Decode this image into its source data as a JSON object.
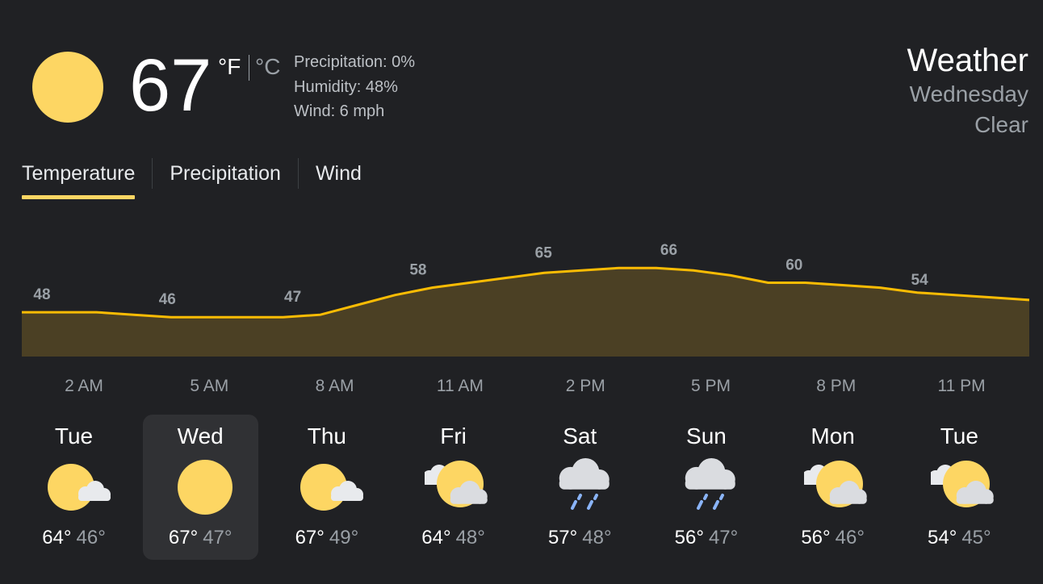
{
  "current": {
    "icon": "sun-icon",
    "temperature": "67",
    "unit_f": "°F",
    "unit_c": "°C",
    "precipitation": "Precipitation: 0%",
    "humidity": "Humidity: 48%",
    "wind": "Wind: 6 mph"
  },
  "place": {
    "title": "Weather",
    "day": "Wednesday",
    "condition": "Clear"
  },
  "tabs": [
    {
      "label": "Temperature",
      "active": true
    },
    {
      "label": "Precipitation",
      "active": false
    },
    {
      "label": "Wind",
      "active": false
    }
  ],
  "colors": {
    "background": "#202124",
    "accent": "#fdd663",
    "chart_fill": "#4b4024",
    "chart_line": "#fbbc04",
    "selected_day_bg": "#303134"
  },
  "chart_data": {
    "type": "area",
    "title": "",
    "xlabel": "",
    "ylabel": "",
    "x_ticks": [
      "2 AM",
      "5 AM",
      "8 AM",
      "11 AM",
      "2 PM",
      "5 PM",
      "8 PM",
      "11 PM"
    ],
    "labeled_values": [
      48,
      46,
      47,
      58,
      65,
      66,
      60,
      54
    ],
    "hourly_values": [
      48,
      48,
      48,
      47,
      46,
      46,
      46,
      46,
      47,
      51,
      55,
      58,
      60,
      62,
      64,
      65,
      66,
      66,
      65,
      63,
      60,
      60,
      59,
      58,
      56,
      55,
      54,
      53
    ],
    "ylim": [
      30,
      70
    ],
    "grid": false,
    "legend": "none"
  },
  "forecast": [
    {
      "day": "Tue",
      "icon": "partly-cloudy-icon",
      "hi": "64°",
      "lo": "46°",
      "selected": false
    },
    {
      "day": "Wed",
      "icon": "sun-icon",
      "hi": "67°",
      "lo": "47°",
      "selected": true
    },
    {
      "day": "Thu",
      "icon": "partly-cloudy-icon",
      "hi": "67°",
      "lo": "49°",
      "selected": false
    },
    {
      "day": "Fri",
      "icon": "mostly-cloudy-icon",
      "hi": "64°",
      "lo": "48°",
      "selected": false
    },
    {
      "day": "Sat",
      "icon": "rain-icon",
      "hi": "57°",
      "lo": "48°",
      "selected": false
    },
    {
      "day": "Sun",
      "icon": "rain-icon",
      "hi": "56°",
      "lo": "47°",
      "selected": false
    },
    {
      "day": "Mon",
      "icon": "mostly-cloudy-icon",
      "hi": "56°",
      "lo": "46°",
      "selected": false
    },
    {
      "day": "Tue",
      "icon": "mostly-cloudy-icon",
      "hi": "54°",
      "lo": "45°",
      "selected": false
    }
  ]
}
